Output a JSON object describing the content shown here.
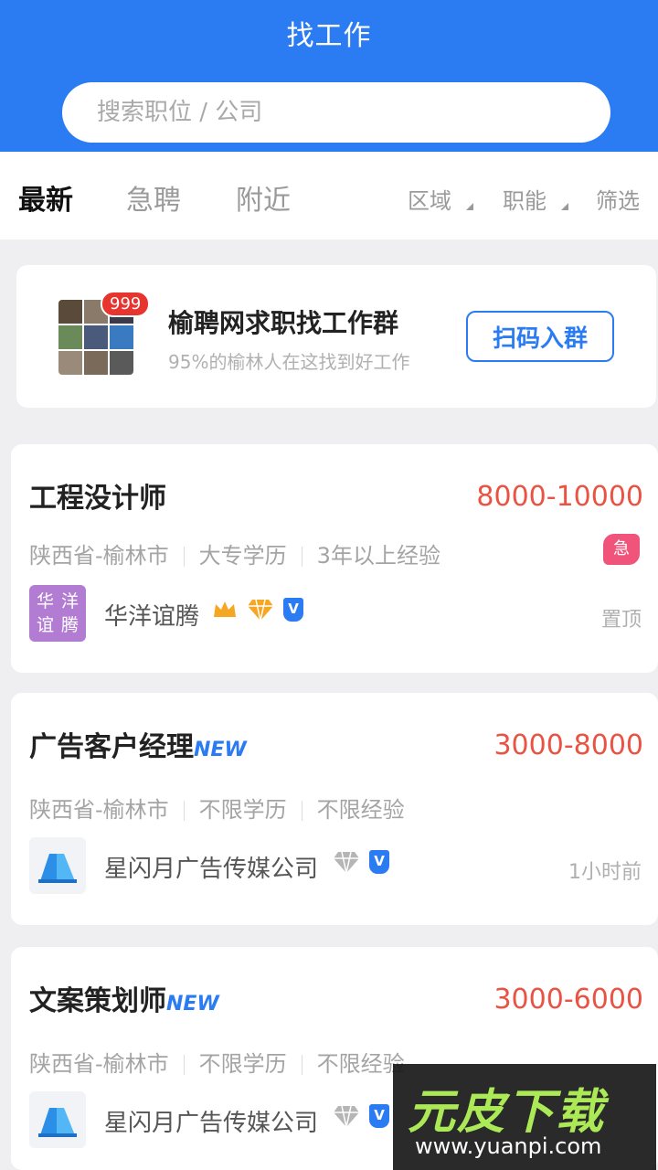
{
  "header": {
    "title": "找工作",
    "search_placeholder": "搜索职位 / 公司"
  },
  "tabs": [
    {
      "label": "最新",
      "active": true
    },
    {
      "label": "急聘",
      "active": false
    },
    {
      "label": "附近",
      "active": false
    }
  ],
  "filters": [
    {
      "label": "区域"
    },
    {
      "label": "职能"
    },
    {
      "label": "筛选"
    }
  ],
  "banner": {
    "title": "榆聘网求职找工作群",
    "subtitle": "95%的榆林人在这找到好工作",
    "badge": "999",
    "button": "扫码入群"
  },
  "jobs": [
    {
      "title": "工程没计师",
      "new_tag": "",
      "salary": "8000-10000",
      "location": "陕西省-榆林市",
      "education": "大专学历",
      "experience": "3年以上经验",
      "company": "华洋谊腾",
      "logo_text": [
        "华",
        "洋",
        "谊",
        "腾"
      ],
      "urgent": "急",
      "right_text": "置顶"
    },
    {
      "title": "广告客户经理",
      "new_tag": "NEW",
      "salary": "3000-8000",
      "location": "陕西省-榆林市",
      "education": "不限学历",
      "experience": "不限经验",
      "company": "星闪月广告传媒公司",
      "right_text": "1小时前"
    },
    {
      "title": "文案策划师",
      "new_tag": "NEW",
      "salary": "3000-6000",
      "location": "陕西省-榆林市",
      "education": "不限学历",
      "experience": "不限经验",
      "company": "星闪月广告传媒公司",
      "right_text": ""
    }
  ],
  "vip_badge": "V",
  "watermark": {
    "brand": "元皮下载",
    "url": "www.yuanpi.com"
  },
  "colors": {
    "primary": "#2b7cf2",
    "salary": "#ea5343",
    "urgent": "#f0547a",
    "logo_purple": "#b17cd2"
  }
}
